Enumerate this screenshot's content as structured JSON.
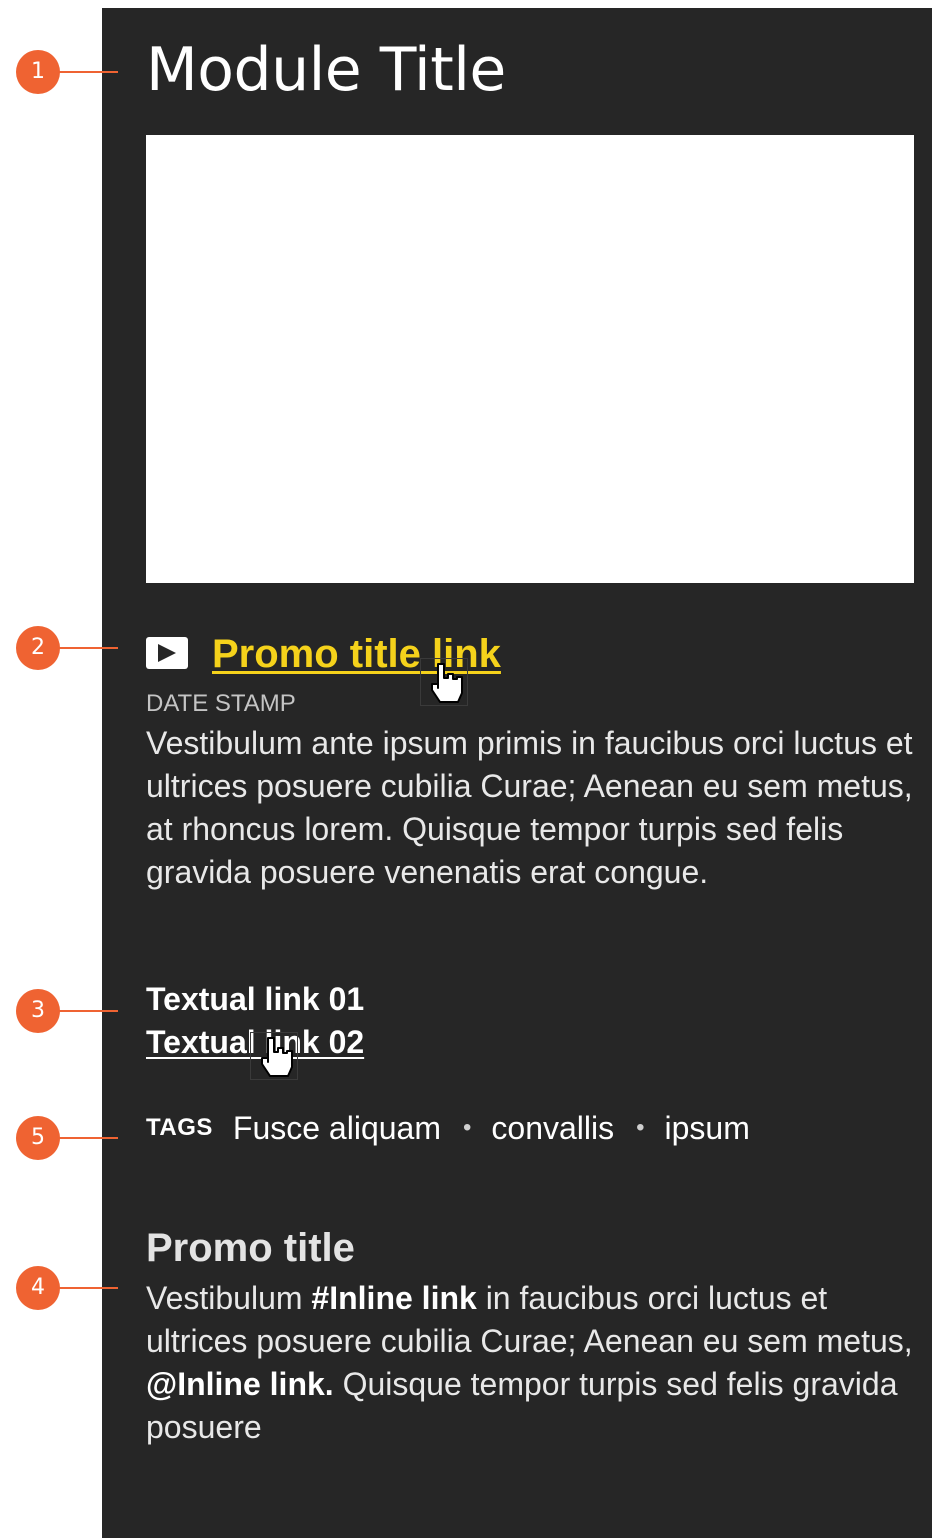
{
  "module": {
    "title": "Module Title"
  },
  "promo": {
    "icon": "play-icon",
    "title_link": "Promo title link",
    "date_stamp": "DATE STAMP",
    "body": "Vestibulum ante ipsum primis in faucibus orci luctus et ultrices posuere cubilia Curae; Aenean eu sem metus, at rhoncus lorem. Quisque tempor turpis sed felis gravida posuere venenatis erat congue.",
    "link_color": "#f5d21b"
  },
  "textual_links": [
    {
      "label": "Textual link 01"
    },
    {
      "label": "Textual link 02"
    }
  ],
  "tags": {
    "label": "TAGS",
    "separator": "•",
    "items": [
      "Fusce aliquam",
      "convallis",
      "ipsum"
    ]
  },
  "promo2": {
    "title": "Promo title",
    "body_part1": "Vestibulum ",
    "inline_link1": "#Inline link",
    "body_part2": " in faucibus orci luctus et ultrices posuere cubilia Curae; Aenean eu sem metus, ",
    "inline_link2": "@Inline link.",
    "body_part3": " Quisque tempor turpis sed felis gravida posuere"
  },
  "annotations": {
    "color": "#ef6332",
    "labels": [
      "1",
      "2",
      "3",
      "5",
      "4"
    ]
  },
  "colors": {
    "panel_background": "#262626",
    "page_background": "#ffffff"
  }
}
